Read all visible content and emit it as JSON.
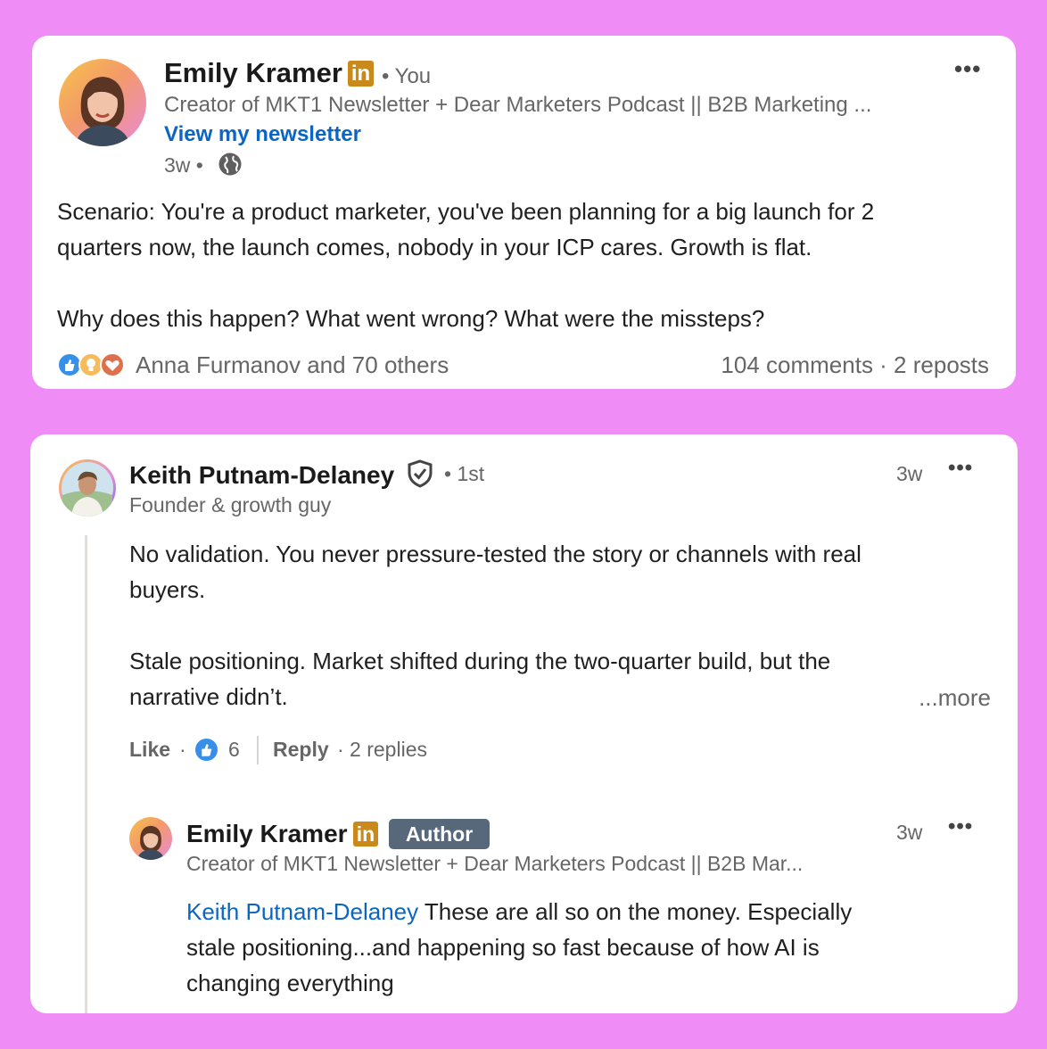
{
  "post": {
    "author": {
      "name": "Emily Kramer",
      "linkedin_badge": "in",
      "relation": "• You",
      "headline": "Creator of MKT1 Newsletter + Dear Marketers Podcast || B2B Marketing ...",
      "newsletter_link": "View my newsletter",
      "time": "3w •",
      "visibility_icon": "globe-icon"
    },
    "menu_icon": "•••",
    "body": [
      "Scenario: You're a product marketer, you've been planning for a big launch for 2",
      "quarters now, the launch comes, nobody in your ICP cares. Growth is flat.",
      "Why does this happen? What went wrong? What were the missteps?"
    ],
    "reactions": {
      "icons": [
        "like-icon",
        "insightful-icon",
        "love-icon"
      ],
      "summary": "Anna Furmanov and 70 others"
    },
    "stats": "104 comments · 2 reposts"
  },
  "comment": {
    "author": {
      "name": "Keith Putnam-Delaney",
      "verified_icon": "verified-shield-icon",
      "degree": "• 1st",
      "headline": "Founder & growth guy"
    },
    "time": "3w",
    "menu_icon": "•••",
    "body": [
      "No validation. You never pressure-tested the story or channels with real",
      "buyers.",
      "Stale positioning. Market shifted during the two-quarter build, but the",
      "narrative didn’t."
    ],
    "more_link": "...more",
    "actions": {
      "like": "Like",
      "sep1": "·",
      "like_count": "6",
      "reply": "Reply",
      "replies": "· 2 replies"
    }
  },
  "reply": {
    "author": {
      "name": "Emily Kramer",
      "linkedin_badge": "in",
      "author_badge": "Author",
      "headline": "Creator of MKT1 Newsletter + Dear Marketers Podcast || B2B Mar..."
    },
    "time": "3w",
    "menu_icon": "•••",
    "mention": "Keith Putnam-Delaney",
    "body_line1_rest": " These are all so on the money. Especially",
    "body_line2": "stale positioning...and happening so fast because of how AI is",
    "body_line3": "changing everything"
  },
  "colors": {
    "background": "#f08cf5",
    "link": "#0a66c2",
    "linkedin_badge": "#c98a1b",
    "author_badge": "#56687a"
  }
}
